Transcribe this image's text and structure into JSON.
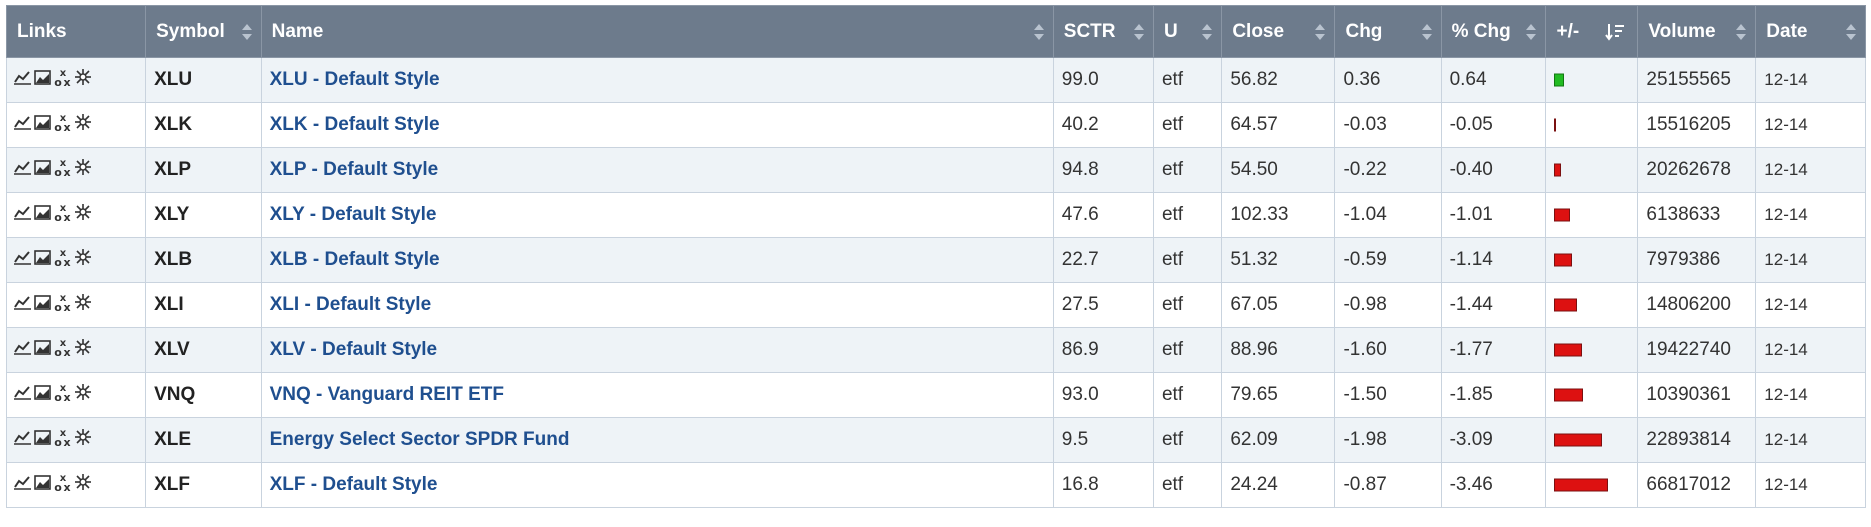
{
  "header": {
    "links": "Links",
    "symbol": "Symbol",
    "name": "Name",
    "sctr": "SCTR",
    "u": "U",
    "close": "Close",
    "chg": "Chg",
    "pchg": "% Chg",
    "plusminus": "+/-",
    "volume": "Volume",
    "date": "Date"
  },
  "colors": {
    "up_bar": "#22bb22",
    "down_bar": "#dd1111",
    "header_bg": "#6d7b8c",
    "link_text": "#1f4f8f"
  },
  "rows": [
    {
      "symbol": "XLU",
      "name": "XLU - Default Style",
      "sctr": "99.0",
      "u": "etf",
      "close": "56.82",
      "chg": "0.36",
      "pchg": "0.64",
      "volume": "25155565",
      "date": "12-14"
    },
    {
      "symbol": "XLK",
      "name": "XLK - Default Style",
      "sctr": "40.2",
      "u": "etf",
      "close": "64.57",
      "chg": "-0.03",
      "pchg": "-0.05",
      "volume": "15516205",
      "date": "12-14"
    },
    {
      "symbol": "XLP",
      "name": "XLP - Default Style",
      "sctr": "94.8",
      "u": "etf",
      "close": "54.50",
      "chg": "-0.22",
      "pchg": "-0.40",
      "volume": "20262678",
      "date": "12-14"
    },
    {
      "symbol": "XLY",
      "name": "XLY - Default Style",
      "sctr": "47.6",
      "u": "etf",
      "close": "102.33",
      "chg": "-1.04",
      "pchg": "-1.01",
      "volume": "6138633",
      "date": "12-14"
    },
    {
      "symbol": "XLB",
      "name": "XLB - Default Style",
      "sctr": "22.7",
      "u": "etf",
      "close": "51.32",
      "chg": "-0.59",
      "pchg": "-1.14",
      "volume": "7979386",
      "date": "12-14"
    },
    {
      "symbol": "XLI",
      "name": "XLI - Default Style",
      "sctr": "27.5",
      "u": "etf",
      "close": "67.05",
      "chg": "-0.98",
      "pchg": "-1.44",
      "volume": "14806200",
      "date": "12-14"
    },
    {
      "symbol": "XLV",
      "name": "XLV - Default Style",
      "sctr": "86.9",
      "u": "etf",
      "close": "88.96",
      "chg": "-1.60",
      "pchg": "-1.77",
      "volume": "19422740",
      "date": "12-14"
    },
    {
      "symbol": "VNQ",
      "name": "VNQ - Vanguard REIT ETF",
      "sctr": "93.0",
      "u": "etf",
      "close": "79.65",
      "chg": "-1.50",
      "pchg": "-1.85",
      "volume": "10390361",
      "date": "12-14"
    },
    {
      "symbol": "XLE",
      "name": "Energy Select Sector SPDR Fund",
      "sctr": "9.5",
      "u": "etf",
      "close": "62.09",
      "chg": "-1.98",
      "pchg": "-3.09",
      "volume": "22893814",
      "date": "12-14"
    },
    {
      "symbol": "XLF",
      "name": "XLF - Default Style",
      "sctr": "16.8",
      "u": "etf",
      "close": "24.24",
      "chg": "-0.87",
      "pchg": "-3.46",
      "volume": "66817012",
      "date": "12-14"
    }
  ],
  "link_icons": [
    "line-chart-icon",
    "area-chart-icon",
    "point-figure-icon",
    "seasonality-icon"
  ]
}
